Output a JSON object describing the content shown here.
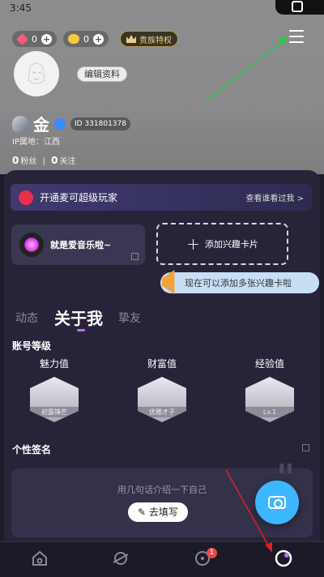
{
  "status_bar": {
    "time": "3:45"
  },
  "currency": {
    "gems": {
      "icon": "gem-icon",
      "value": "0"
    },
    "coins": {
      "icon": "coin-icon",
      "value": "0"
    },
    "vip_label": "贵族特权"
  },
  "profile": {
    "edit_label": "编辑资料",
    "name": "金",
    "id_label": "ID 331801378",
    "ip_location": "IP属地：江西",
    "fans_count": "0",
    "fans_label": "粉丝",
    "follow_count": "0",
    "follow_label": "关注"
  },
  "vip_banner": {
    "text": "开通麦可超级玩家",
    "link": "查看谁看过我 >"
  },
  "interest": {
    "music_card": "就是爱音乐啦~",
    "add_card": "添加兴趣卡片",
    "tip": "现在可以添加多张兴趣卡啦"
  },
  "tabs": [
    {
      "label": "动态",
      "active": false
    },
    {
      "label": "关于我",
      "active": true
    },
    {
      "label": "挚友",
      "active": false
    }
  ],
  "levels": {
    "title": "账号等级",
    "items": [
      {
        "label": "魅力值",
        "ribbon": "初露锋芒"
      },
      {
        "label": "财富值",
        "ribbon": "优雅才子"
      },
      {
        "label": "经验值",
        "ribbon": "Lv.1"
      }
    ]
  },
  "signature": {
    "title": "个性签名",
    "hint": "用几句话介绍一下自己",
    "button": "去填写"
  },
  "bottom_nav": {
    "items": [
      {
        "icon": "home-icon"
      },
      {
        "icon": "planet-icon"
      },
      {
        "icon": "chat-icon",
        "badge": "1"
      },
      {
        "icon": "profile-icon"
      }
    ]
  },
  "annotations": {
    "arrow_color": "#22cc44",
    "arrow2_color": "#e02020"
  }
}
